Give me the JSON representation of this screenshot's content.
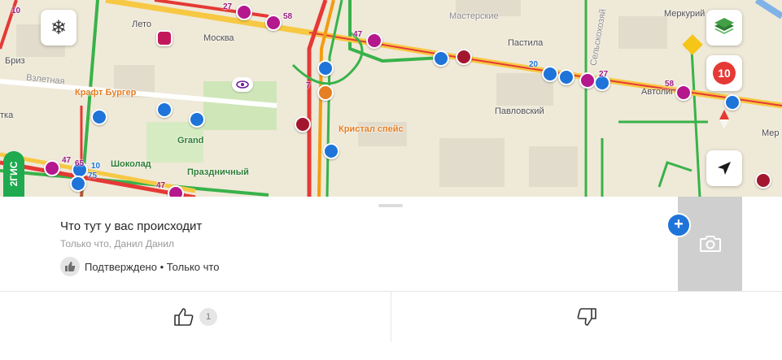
{
  "map": {
    "labels": {
      "leto": "Лето",
      "moskva": "Москва",
      "briz": "Бриз",
      "vzletnaya": "Взлетная",
      "kraft_burger": "Крафт Бургер",
      "grand": "Grand",
      "shokolad": "Шоколад",
      "prazdnichny": "Праздничный",
      "kristal_speis": "Кристал спейс",
      "masterskie": "Мастерские",
      "pastila": "Пастила",
      "pavlovsky": "Павловский",
      "merkury": "Меркурий",
      "avtoliga": "Автолиг",
      "sel_hoz": "Сельскохозяй",
      "tka": "тка",
      "mer": "Мер"
    },
    "routes": {
      "r10": "10",
      "r27a": "27",
      "r58a": "58",
      "r47a": "47",
      "r20": "20",
      "r27b": "27",
      "r58b": "58",
      "r47b": "47",
      "r65": "65",
      "r10b": "10",
      "r75": "75",
      "r47c": "47",
      "r7": "7"
    },
    "traffic_score": "10",
    "logo_text": "2ГИС"
  },
  "event": {
    "title": "Что тут у вас происходит",
    "meta": "Только что, Данил Данил",
    "confirm_text": "Подтверждено • Только что"
  },
  "actions": {
    "like_count": "1"
  },
  "colors": {
    "accent": "#1e74d9",
    "traffic_red": "#e53935",
    "brand_green": "#1faa4f",
    "route_purple": "#b5178d"
  },
  "icons": {
    "snow": "snowflake-icon",
    "layers": "layers-icon",
    "compass": "compass-icon",
    "locate": "location-arrow-icon",
    "camera": "camera-icon",
    "thumbs_up": "thumbs-up-icon",
    "thumbs_down": "thumbs-down-icon"
  }
}
